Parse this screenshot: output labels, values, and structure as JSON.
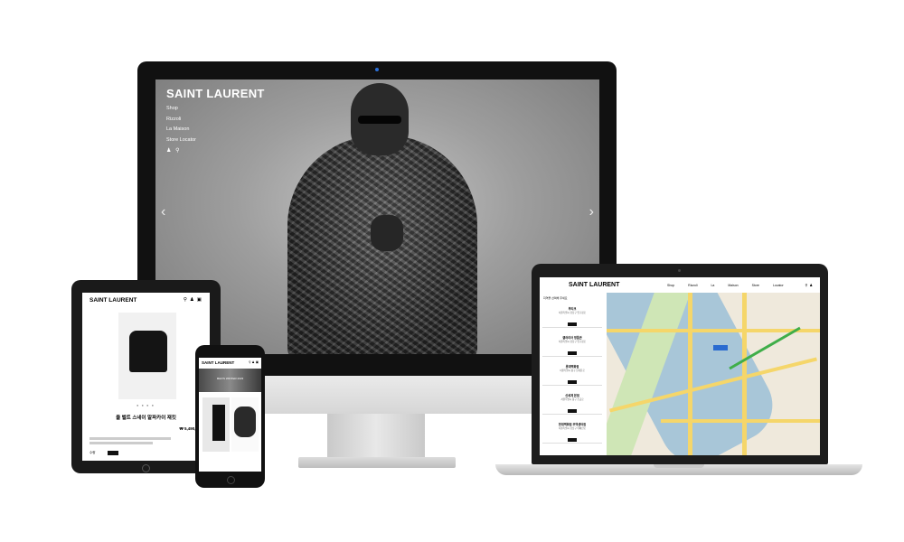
{
  "desktop": {
    "brand": "SAINT LAURENT",
    "menu": [
      "Shop",
      "Rizzoli",
      "La Maison",
      "Store Locator"
    ],
    "icons": [
      "user-icon",
      "search-icon"
    ],
    "prev_arrow": "‹",
    "next_arrow": "›"
  },
  "tablet": {
    "brand": "SAINT LAURENT",
    "icons": [
      "search-icon",
      "user-icon",
      "bag-icon"
    ],
    "product_title": "울 벨트 스네이 알파카이 재킷",
    "price": "₩ 5,490,000",
    "qty_label": "수량"
  },
  "phone": {
    "brand": "SAINT LAURENT",
    "icons": [
      "search-icon",
      "user-icon",
      "bag-icon"
    ],
    "banner_text": "MEN'S WINTER 2023"
  },
  "laptop": {
    "brand": "SAINT LAURENT",
    "nav": [
      "Shop",
      "Rizzoli",
      "La Maison",
      "Store Locator"
    ],
    "icons": [
      "search-icon",
      "user-icon"
    ],
    "filter_label": "지역을 선택해 주세요",
    "stores": [
      {
        "name": "부티크",
        "address": "서울특별시 강남구 압구정로"
      },
      {
        "name": "갤러리아 명품관",
        "address": "서울특별시 강남구 압구정로"
      },
      {
        "name": "롯데백화점",
        "address": "서울특별시 중구 남대문로"
      },
      {
        "name": "신세계 본점",
        "address": "서울특별시 중구 소공로"
      },
      {
        "name": "현대백화점 무역센터점",
        "address": "서울특별시 강남구 테헤란로"
      }
    ]
  }
}
